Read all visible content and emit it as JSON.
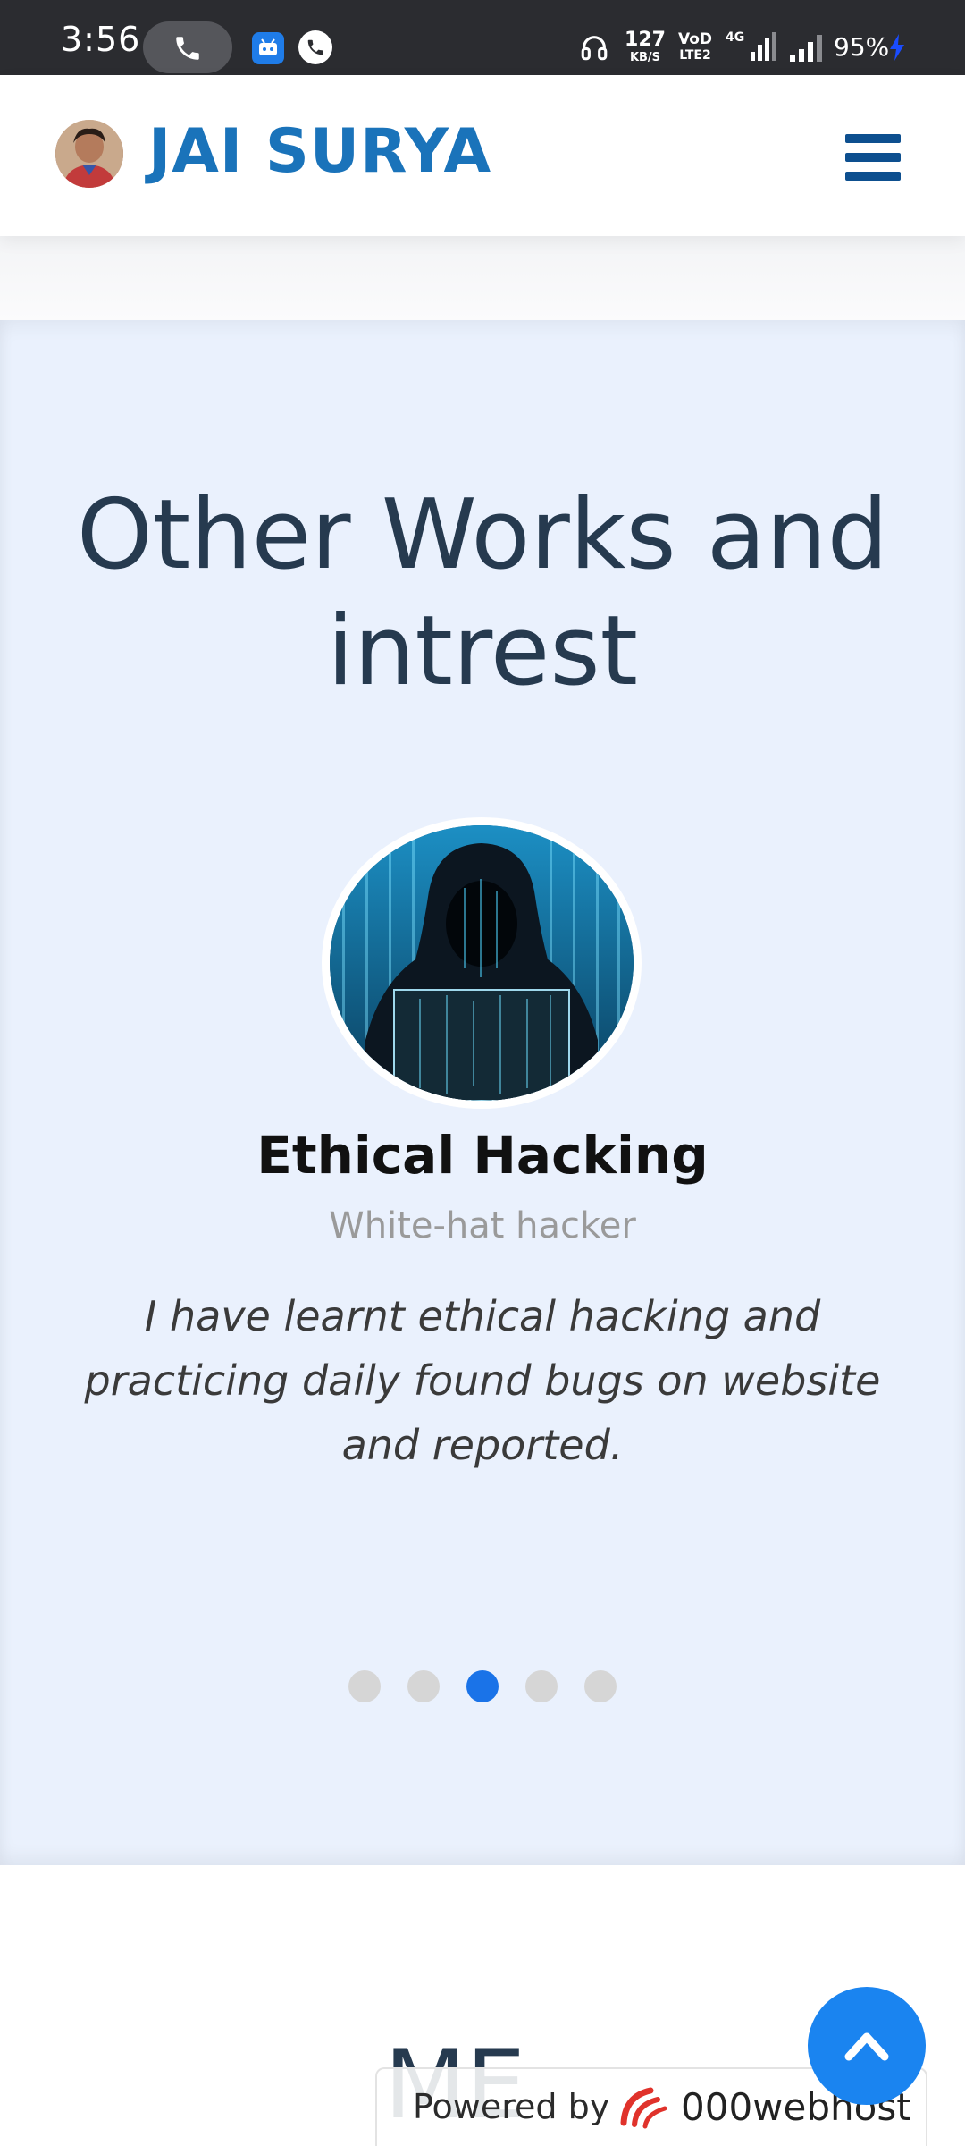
{
  "status_bar": {
    "time": "3:56",
    "net_speed_value": "127",
    "net_speed_unit": "KB/S",
    "volte_top": "VoD",
    "volte_bottom": "LTE2",
    "signal_label": "4G",
    "battery": "95%",
    "icons": [
      "phone-icon",
      "app-notification-icon",
      "whatsapp-icon",
      "headset-icon",
      "signal-icon",
      "charging-icon"
    ]
  },
  "header": {
    "brand_name": "JAI SURYA",
    "menu_icon": "hamburger-menu-icon",
    "brand_color": "#1a73ba"
  },
  "works": {
    "title": "Other Works and intrest",
    "item_title": "Ethical Hacking",
    "item_subtitle": "White-hat hacker",
    "item_description": "I have learnt ethical hacking and practicing daily found bugs on website and reported.",
    "carousel_dot_count": 5,
    "active_dot_index": 2,
    "accent_color": "#1a73e8",
    "background_color": "#eaf1fd"
  },
  "next_section": {
    "heading": "ME"
  },
  "footer": {
    "powered_by": "Powered by",
    "host_name": "000webhost",
    "scroll_top_icon": "chevron-up-icon"
  }
}
